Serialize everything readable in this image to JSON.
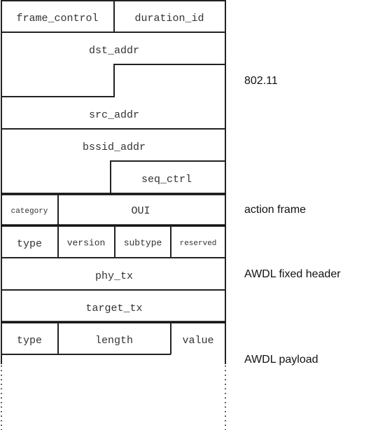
{
  "fields": {
    "frame_control": "frame_control",
    "duration_id": "duration_id",
    "dst_addr": "dst_addr",
    "src_addr": "src_addr",
    "bssid_addr": "bssid_addr",
    "seq_ctrl": "seq_ctrl",
    "category": "category",
    "oui": "OUI",
    "type": "type",
    "version": "version",
    "subtype": "subtype",
    "reserved": "reserved",
    "phy_tx": "phy_tx",
    "target_tx": "target_tx",
    "tlv_type": "type",
    "tlv_length": "length",
    "tlv_value": "value"
  },
  "sections": {
    "ieee": "802.11",
    "action": "action frame",
    "fixed": "AWDL fixed header",
    "payload": "AWDL payload"
  }
}
